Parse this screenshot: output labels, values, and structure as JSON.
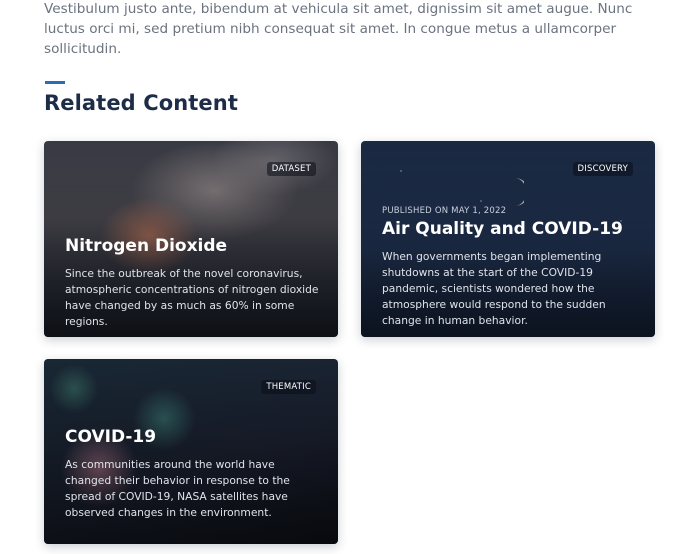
{
  "intro": {
    "text": "Vestibulum justo ante, bibendum at vehicula sit amet, dignissim sit amet augue. Nunc luctus orci mi, sed pretium nibh consequat sit amet. In congue metus a ullamcorper sollicitudin."
  },
  "section": {
    "title": "Related Content"
  },
  "cards": [
    {
      "tag": "DATASET",
      "title": "Nitrogen Dioxide",
      "description": "Since the outbreak of the novel coronavirus, atmospheric concentrations of nitrogen dioxide have changed by as much as 60% in some regions."
    },
    {
      "tag": "DISCOVERY",
      "meta": "PUBLISHED ON MAY 1, 2022",
      "title": "Air Quality and COVID-19",
      "description": "When governments began implementing shutdowns at the start of the COVID-19 pandemic, scientists wondered how the atmosphere would respond to the sudden change in human behavior."
    },
    {
      "tag": "THEMATIC",
      "title": "COVID-19",
      "description": "As communities around the world have changed their behavior in response to the spread of COVID-19, NASA satellites have observed changes in the environment."
    }
  ]
}
